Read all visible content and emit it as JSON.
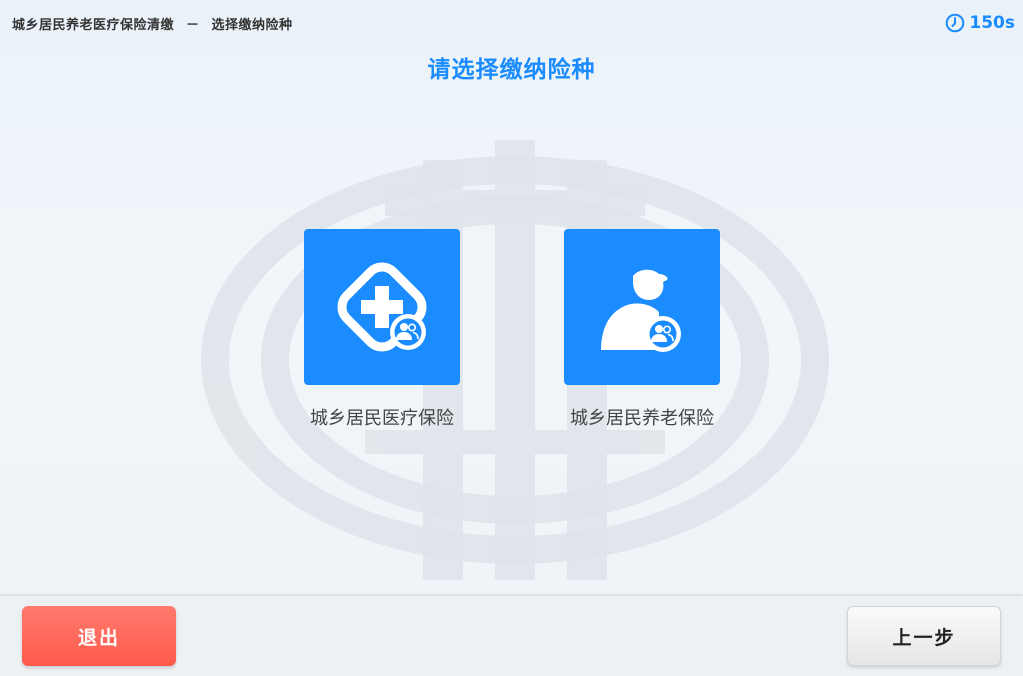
{
  "header": {
    "breadcrumb_main": "城乡居民养老医疗保险清缴",
    "breadcrumb_sep": "－",
    "breadcrumb_current": "选择缴纳险种",
    "timer_value": "150s"
  },
  "main": {
    "title": "请选择缴纳险种",
    "options": [
      {
        "label": "城乡居民医疗保险",
        "icon": "medical-cross-user-icon"
      },
      {
        "label": "城乡居民养老保险",
        "icon": "elderly-person-user-icon"
      }
    ]
  },
  "footer": {
    "exit_label": "退出",
    "back_label": "上一步"
  },
  "colors": {
    "accent": "#1a8cff",
    "exit": "#ff5a4c",
    "background": "#eef3f8"
  }
}
